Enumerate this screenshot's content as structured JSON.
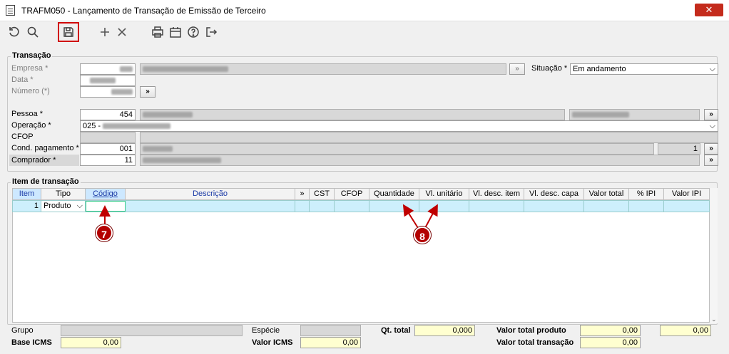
{
  "window": {
    "title": "TRAFM050 - Lançamento de Transação de Emissão de Terceiro",
    "close": "✕"
  },
  "toolbar": {
    "icons": [
      "refresh-icon",
      "search-icon",
      "save-icon",
      "add-icon",
      "delete-icon",
      "print-icon",
      "calendar-icon",
      "help-icon",
      "exit-icon"
    ]
  },
  "transacao": {
    "group_title": "Transação",
    "empresa_label": "Empresa *",
    "data_label": "Data *",
    "numero_label": "Número (*)",
    "situacao_label": "Situação *",
    "situacao_value": "Em andamento",
    "pessoa_label": "Pessoa *",
    "pessoa_value": "454",
    "operacao_label": "Operação *",
    "operacao_value": "025 -",
    "cfop_label": "CFOP",
    "cond_label": "Cond. pagamento *",
    "cond_value": "001",
    "cond_parcelas": "1",
    "comprador_label": "Comprador *",
    "comprador_value": "11",
    "nav": "»"
  },
  "item": {
    "group_title": "Item de transação",
    "columns": [
      "Item",
      "Tipo",
      "Código",
      "Descrição",
      "»",
      "CST",
      "CFOP",
      "Quantidade",
      "Vl. unitário",
      "Vl. desc. item",
      "Vl. desc. capa",
      "Valor total",
      "% IPI",
      "Valor IPI"
    ],
    "row": {
      "item": "1",
      "tipo": "Produto"
    }
  },
  "footer": {
    "grupo_label": "Grupo",
    "base_icms_label": "Base ICMS",
    "base_icms_value": "0,00",
    "especie_label": "Espécie",
    "valor_icms_label": "Valor ICMS",
    "valor_icms_value": "0,00",
    "qt_total_label": "Qt. total",
    "qt_total_value": "0,000",
    "vtp_label": "Valor total produto",
    "vtp_value": "0,00",
    "vtt_label": "Valor total transação",
    "vtt_value": "0,00",
    "ipi_total_value": "0,00"
  },
  "markers": {
    "m7": "7",
    "m8": "8"
  },
  "colors": {
    "accent": "#1a3aa6",
    "marker": "#b30000",
    "highlight": "#d00000"
  }
}
